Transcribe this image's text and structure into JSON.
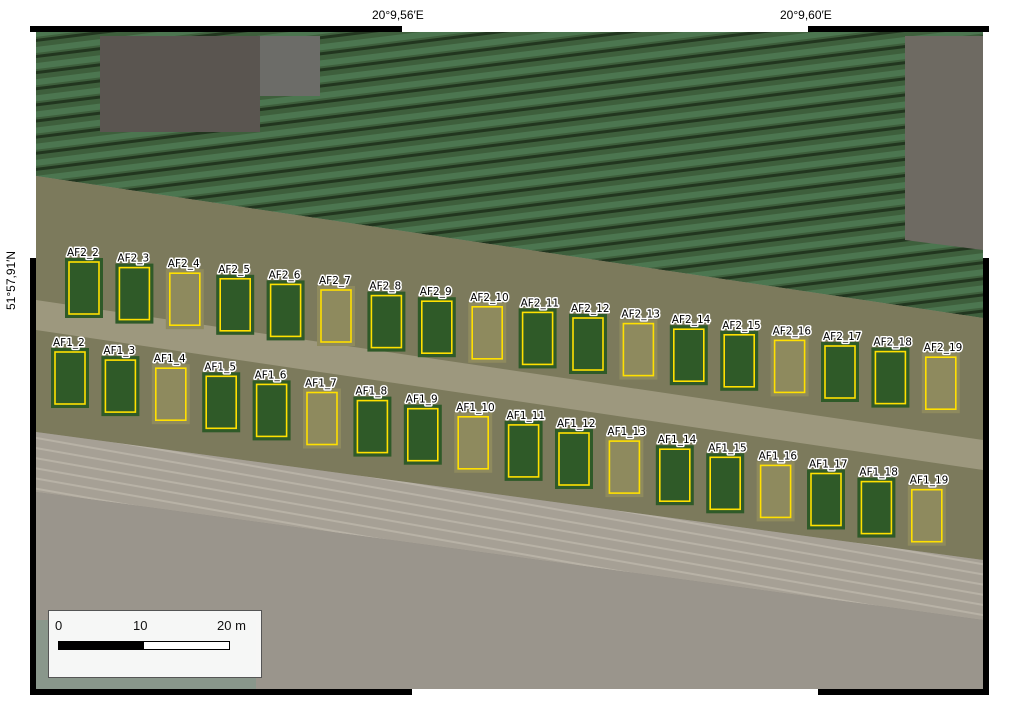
{
  "coords": {
    "top": [
      "20°9,56′E",
      "20°9,60′E"
    ],
    "left": "51°57,91′N"
  },
  "scalebar": {
    "labels": [
      "0",
      "10",
      "20 m"
    ]
  },
  "colors": {
    "plot_outline_yellow": "#ffe000",
    "plot_outline_dark": "#2e3a10"
  },
  "rows": [
    {
      "name": "AF2",
      "plots": [
        "AF2_2",
        "AF2_3",
        "AF2_4",
        "AF2_5",
        "AF2_6",
        "AF2_7",
        "AF2_8",
        "AF2_9",
        "AF2_10",
        "AF2_11",
        "AF2_12",
        "AF2_13",
        "AF2_14",
        "AF2_15",
        "AF2_16",
        "AF2_17",
        "AF2_18",
        "AF2_19"
      ]
    },
    {
      "name": "AF1",
      "plots": [
        "AF1_2",
        "AF1_3",
        "AF1_4",
        "AF1_5",
        "AF1_6",
        "AF1_7",
        "AF1_8",
        "AF1_9",
        "AF1_10",
        "AF1_11",
        "AF1_12",
        "AF1_13",
        "AF1_14",
        "AF1_15",
        "AF1_16",
        "AF1_17",
        "AF1_18",
        "AF1_19"
      ]
    }
  ],
  "plot_greenness": {
    "AF2": [
      1,
      1,
      0,
      1,
      1,
      0,
      1,
      1,
      0,
      1,
      1,
      0,
      1,
      1,
      0,
      1,
      1,
      0
    ],
    "AF1": [
      1,
      1,
      0,
      1,
      1,
      0,
      1,
      1,
      0,
      1,
      1,
      0,
      1,
      1,
      0,
      1,
      1,
      0
    ]
  }
}
